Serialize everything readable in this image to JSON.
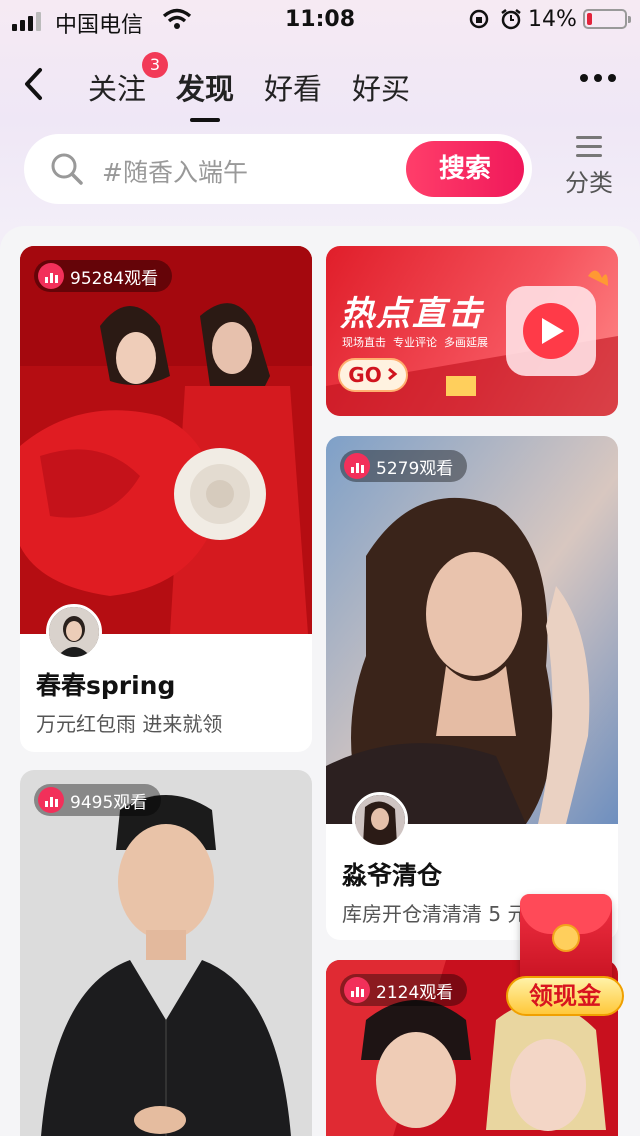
{
  "status_bar": {
    "carrier": "中国电信",
    "time": "11:08",
    "battery": "14%"
  },
  "nav": {
    "tabs": [
      {
        "label": "关注",
        "badge": "3"
      },
      {
        "label": "发现",
        "active": true
      },
      {
        "label": "好看"
      },
      {
        "label": "好买"
      }
    ]
  },
  "search": {
    "placeholder": "#随香入端午",
    "button": "搜索",
    "category_label": "分类"
  },
  "feed": {
    "cards": [
      {
        "views": "95284观看",
        "title": "春春spring",
        "subtitle": "万元红包雨 进来就领"
      },
      {
        "banner_title": "热点直击",
        "banner_tags": "现场直击  专业评论  多画延展",
        "banner_go": "GO"
      },
      {
        "views": "5279观看",
        "title": "淼爷清仓",
        "subtitle": "库房开仓清清清 5 元"
      },
      {
        "views": "9495观看"
      },
      {
        "views": "2124观看"
      }
    ]
  },
  "float_envelope": {
    "label": "领现金"
  },
  "colors": {
    "accent": "#f0185a",
    "badge": "#f23a57"
  }
}
